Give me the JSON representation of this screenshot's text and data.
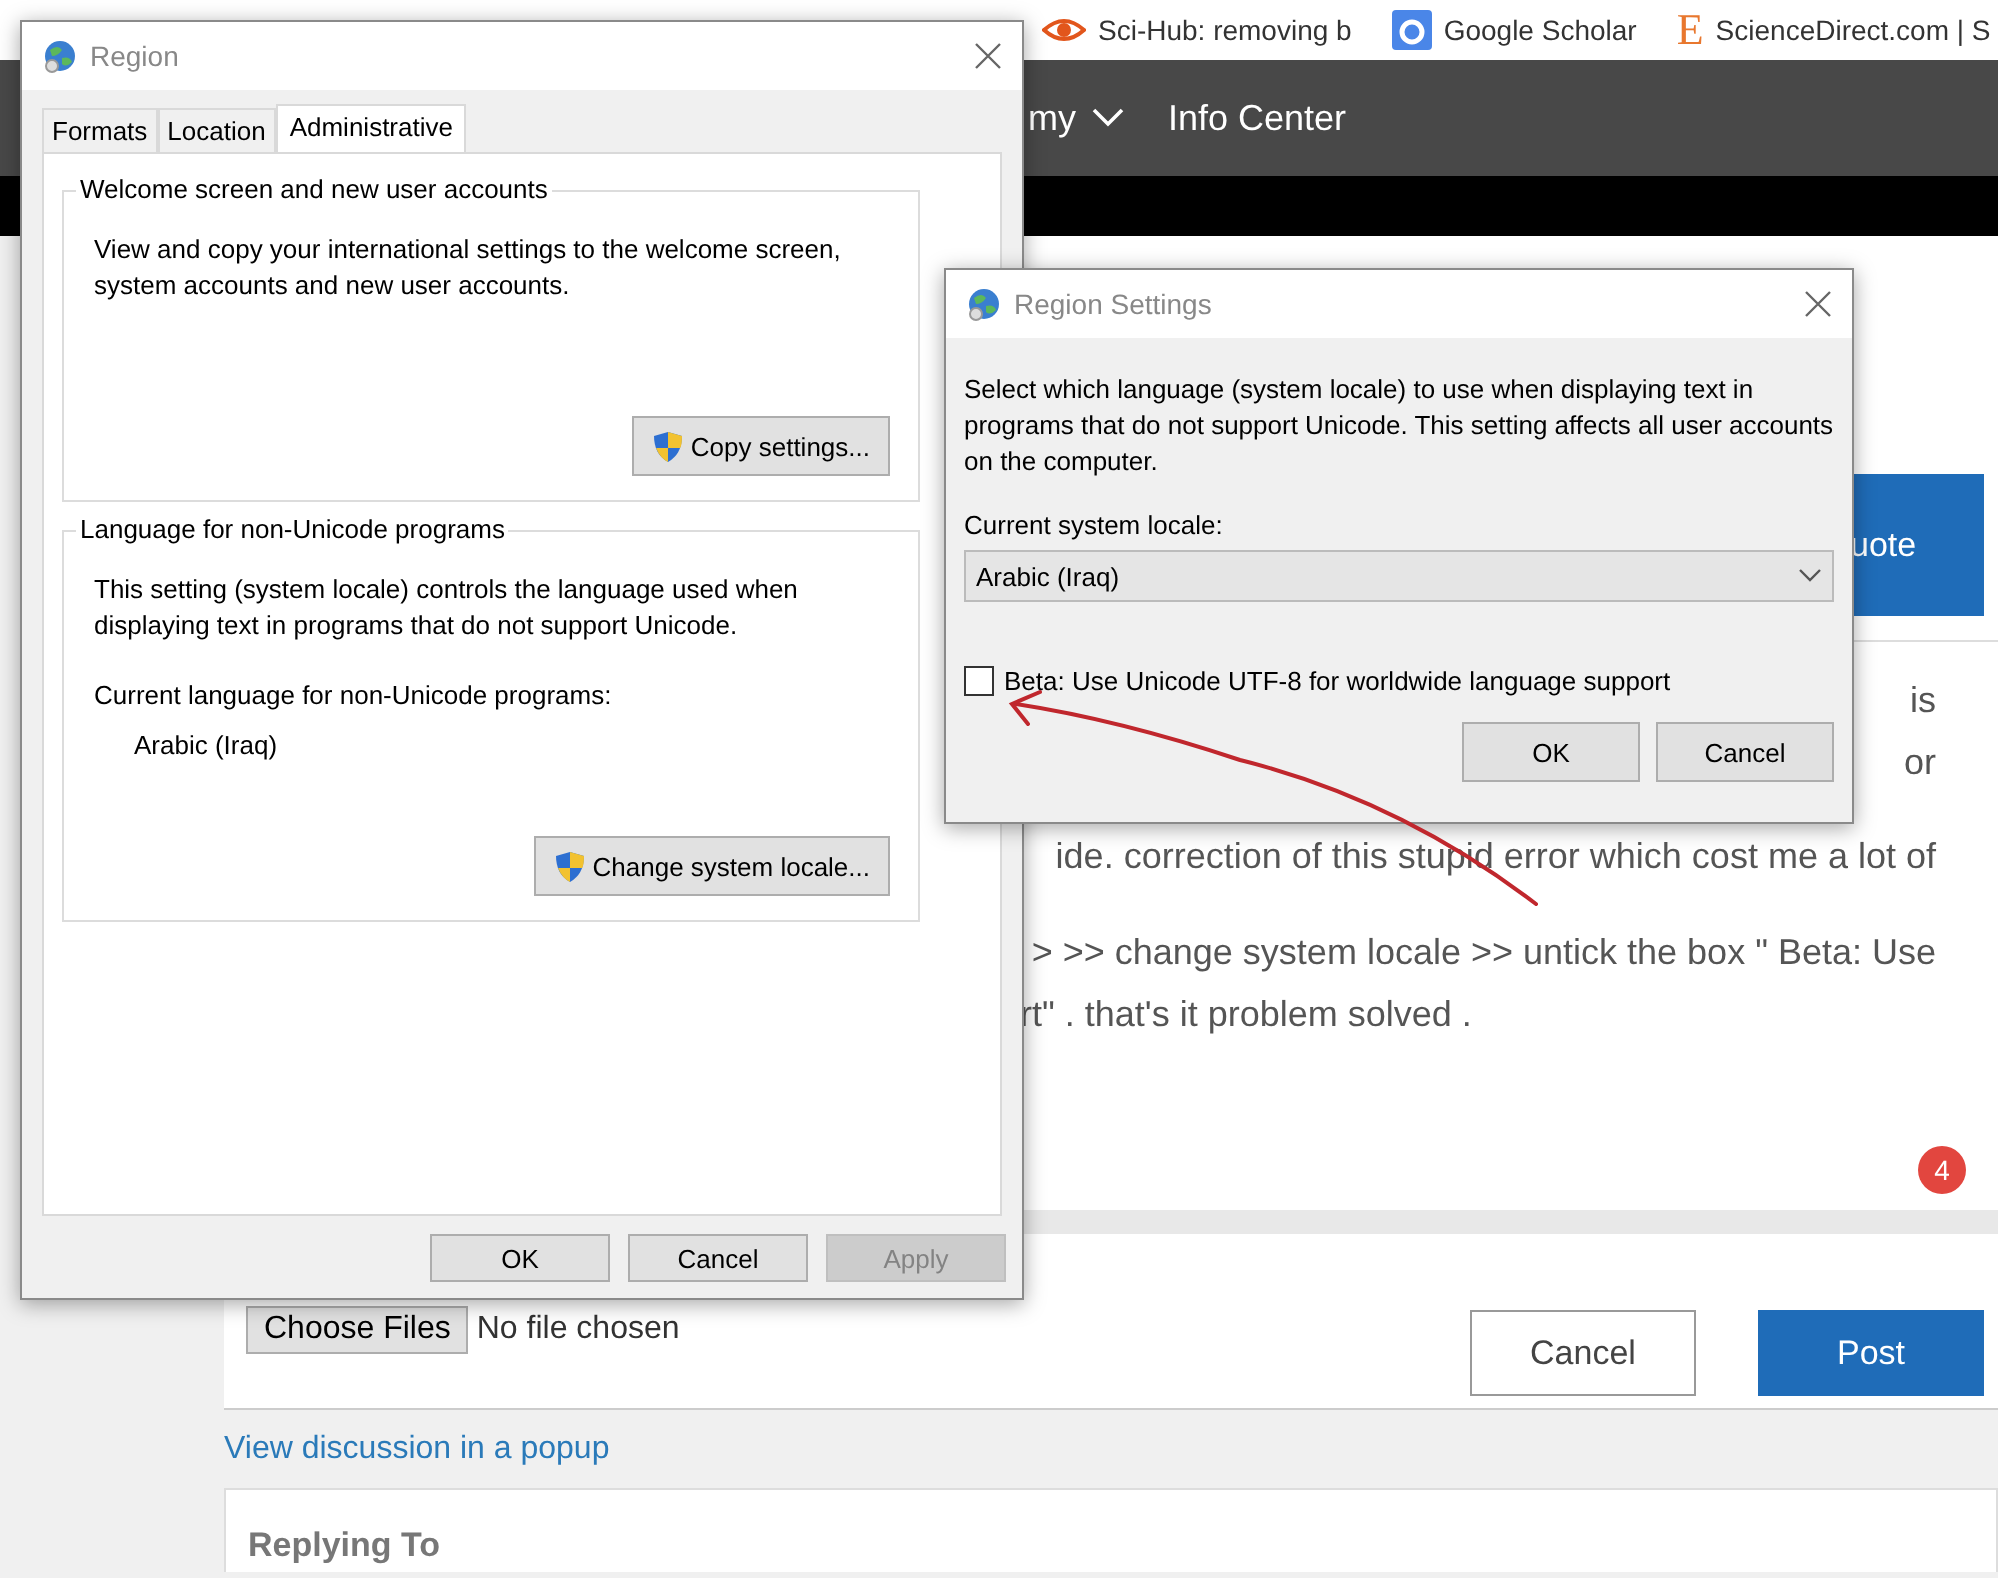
{
  "bookmarks": [
    {
      "label": "Sci-Hub: removing b"
    },
    {
      "label": "Google Scholar"
    },
    {
      "icon_text": "E",
      "label": "ScienceDirect.com | S"
    }
  ],
  "nav": {
    "items": [
      {
        "label": "my",
        "dropdown": true
      },
      {
        "label": "Info Center",
        "dropdown": false
      }
    ]
  },
  "post": {
    "quote_button": "uote",
    "text_lines": [
      {
        "kind": "end",
        "text": "is"
      },
      {
        "kind": "end",
        "text": "or"
      },
      {
        "kind": "end",
        "text": "ide. correction of this stupid error which cost me a lot of"
      },
      {
        "kind": "end",
        "text": "> >> change system locale >> untick the box \" Beta: Use"
      },
      {
        "kind": "start",
        "text": "rt\" . that's it problem solved ."
      }
    ],
    "badge": "4"
  },
  "attachments": {
    "choose_button": "Choose Files",
    "status": "No file chosen"
  },
  "actions": [
    {
      "label": "Cancel",
      "kind": "secondary"
    },
    {
      "label": "Post",
      "kind": "primary"
    }
  ],
  "popup_link": "View discussion in a popup",
  "replying_to": "Replying To",
  "region_dialog": {
    "title": "Region",
    "tabs": [
      {
        "label": "Formats",
        "selected": false
      },
      {
        "label": "Location",
        "selected": false
      },
      {
        "label": "Administrative",
        "selected": true
      }
    ],
    "groups": [
      {
        "title": "Welcome screen and new user accounts",
        "description": "View and copy your international settings to the welcome screen, system accounts and new user accounts.",
        "button": "Copy settings..."
      },
      {
        "title": "Language for non-Unicode programs",
        "description": "This setting (system locale) controls the language used when displaying text in programs that do not support Unicode.",
        "current_label": "Current language for non-Unicode programs:",
        "current_value": "Arabic (Iraq)",
        "button": "Change system locale..."
      }
    ],
    "buttons": [
      {
        "label": "OK",
        "disabled": false
      },
      {
        "label": "Cancel",
        "disabled": false
      },
      {
        "label": "Apply",
        "disabled": true
      }
    ]
  },
  "region_settings_dialog": {
    "title": "Region Settings",
    "description": "Select which language (system locale) to use when displaying text in programs that do not support Unicode. This setting affects all user accounts on the computer.",
    "locale_label": "Current system locale:",
    "locale_value": "Arabic (Iraq)",
    "checkbox": {
      "label": "Beta: Use Unicode UTF-8 for worldwide language support",
      "checked": false
    },
    "buttons": [
      {
        "label": "OK",
        "disabled": false
      },
      {
        "label": "Cancel",
        "disabled": false
      }
    ]
  }
}
